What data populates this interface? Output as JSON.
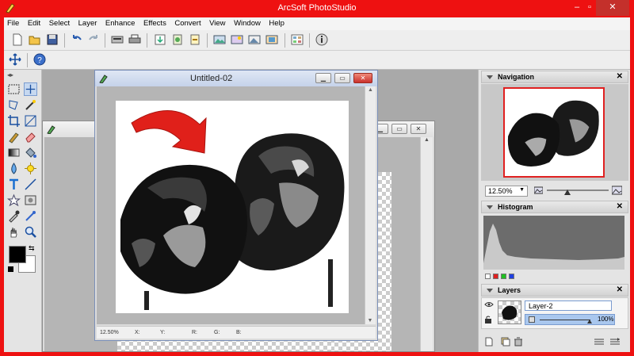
{
  "app": {
    "title": "ArcSoft PhotoStudio",
    "close_glyph": "✕"
  },
  "menu": [
    "File",
    "Edit",
    "Select",
    "Layer",
    "Enhance",
    "Effects",
    "Convert",
    "View",
    "Window",
    "Help"
  ],
  "document": {
    "title": "Untitled-02",
    "status": {
      "zoom": "12.50%",
      "x": "X:",
      "y": "Y:",
      "r": "R:",
      "g": "G:",
      "b": "B:"
    }
  },
  "panels": {
    "navigation": {
      "title": "Navigation",
      "zoom": "12.50%"
    },
    "histogram": {
      "title": "Histogram"
    },
    "layers": {
      "title": "Layers",
      "layer_name": "Layer-2",
      "opacity": "100%"
    }
  },
  "colors": {
    "frame": "#ee1111",
    "foreground": "#000000",
    "background": "#ffffff",
    "arrow": "#e0201a"
  },
  "icons": [
    "move-icon",
    "help-icon",
    "undo-icon",
    "redo-icon",
    "save-icon",
    "open-icon",
    "print-icon"
  ]
}
